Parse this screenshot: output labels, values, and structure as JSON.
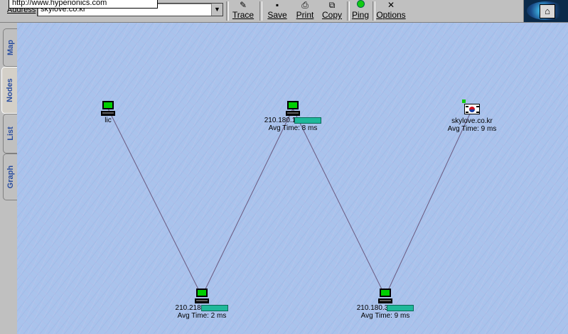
{
  "toolbar": {
    "address_label": "Address",
    "address_value": "skylove.co.kr",
    "tooltip_url": "http://www.hyperionics.com",
    "buttons": [
      {
        "label": "Trace",
        "icon": "trace-icon"
      },
      {
        "label": "Save",
        "icon": "save-icon"
      },
      {
        "label": "Print",
        "icon": "print-icon"
      },
      {
        "label": "Copy",
        "icon": "copy-icon"
      },
      {
        "label": "Ping",
        "icon": "ping-icon"
      },
      {
        "label": "Options",
        "icon": "options-icon"
      }
    ]
  },
  "tabs": [
    {
      "label": "Map",
      "active": false
    },
    {
      "label": "Nodes",
      "active": true
    },
    {
      "label": "List",
      "active": false
    },
    {
      "label": "Graph",
      "active": false
    }
  ],
  "nodes": [
    {
      "id": "lic",
      "label": "lic",
      "type": "pc",
      "avg": ""
    },
    {
      "id": "n210_180_a",
      "label": "210.180.1",
      "type": "pc",
      "avg": "Avg Time: 8 ms"
    },
    {
      "id": "skylove",
      "label": "skylove.co.kr",
      "type": "flag",
      "avg": "Avg Time: 9 ms"
    },
    {
      "id": "n210_218",
      "label": "210.218.",
      "type": "pc",
      "avg": "Avg Time: 2 ms"
    },
    {
      "id": "n210_180_b",
      "label": "210.180.3",
      "type": "pc",
      "avg": "Avg Time: 9 ms"
    }
  ],
  "links": [
    [
      "lic",
      "n210_218"
    ],
    [
      "n210_218",
      "n210_180_a"
    ],
    [
      "n210_180_a",
      "n210_180_b"
    ],
    [
      "n210_180_b",
      "skylove"
    ]
  ],
  "colors": {
    "canvas": "#a9c3ec",
    "screen": "#00d000",
    "bar": "#1fb89a",
    "tab_text": "#2a4ea0"
  }
}
